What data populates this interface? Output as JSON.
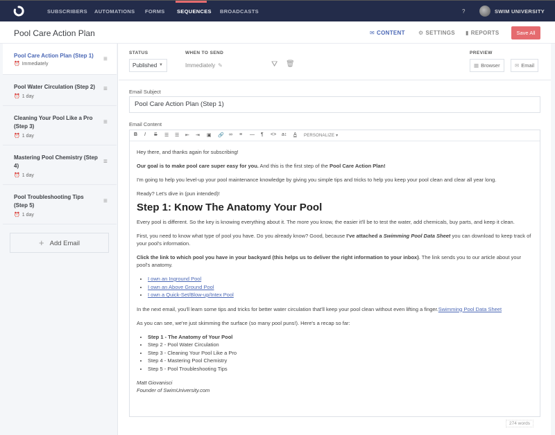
{
  "nav": {
    "items": [
      "SUBSCRIBERS",
      "AUTOMATIONS",
      "FORMS",
      "SEQUENCES",
      "BROADCASTS"
    ],
    "active": "SEQUENCES",
    "help": "?",
    "account": "SWIM UNIVERSITY",
    "accent": "#e56b6f"
  },
  "header": {
    "title": "Pool Care Action Plan",
    "tabs": [
      {
        "label": "CONTENT",
        "icon": "envelope-icon",
        "active": true
      },
      {
        "label": "SETTINGS",
        "icon": "gear-icon",
        "active": false
      },
      {
        "label": "REPORTS",
        "icon": "bar-chart-icon",
        "active": false
      }
    ],
    "save_label": "Save All"
  },
  "sidebar": {
    "emails": [
      {
        "title": "Pool Care Action Plan (Step 1)",
        "delay": "Immediately",
        "active": true
      },
      {
        "title": "Pool Water Circulation (Step 2)",
        "delay": "1 day"
      },
      {
        "title": "Cleaning Your Pool Like a Pro (Step 3)",
        "delay": "1 day"
      },
      {
        "title": "Mastering Pool Chemistry (Step 4)",
        "delay": "1 day"
      },
      {
        "title": "Pool Troubleshooting Tips (Step 5)",
        "delay": "1 day"
      }
    ],
    "add_label": "Add Email"
  },
  "settings": {
    "status_label": "STATUS",
    "status_value": "Published",
    "when_label": "WHEN TO SEND",
    "when_value": "Immediately",
    "preview_label": "PREVIEW",
    "preview_browser": "Browser",
    "preview_email": "Email"
  },
  "email": {
    "subject_label": "Email Subject",
    "subject_value": "Pool Care Action Plan (Step 1)",
    "content_label": "Email Content",
    "toolbar": [
      "B",
      "I",
      "S",
      "ul",
      "ol",
      "outdent",
      "indent",
      "image",
      "link",
      "unlink",
      "align",
      "hr",
      "pilcrow",
      "code",
      "font-size",
      "text-color"
    ],
    "personalize": "PERSONALIZE ▾",
    "body": {
      "p1": "Hey there, and thanks again for subscribing!",
      "p2_bold": "Our goal is to make pool care super easy for you.",
      "p2_rest": " And this is the first step of the ",
      "p2_bold2": "Pool Care Action Plan!",
      "p3": "I'm going to help you level-up your pool maintenance knowledge by giving you simple tips and tricks to help you keep your pool clean and clear all year long.",
      "p4": "Ready? Let's dive in (pun intended)!",
      "heading": "Step 1: Know The Anatomy Your Pool",
      "p5": "Every pool is different. So the key is knowing everything about it. The more you know, the easier it'll be to test the water, add chemicals, buy parts, and keep it clean.",
      "p6_a": "First, you need to know what type of pool you have. Do you already know? Good, because ",
      "p6_bold": "I've attached a ",
      "p6_bi": "Swimming Pool Data Sheet",
      "p6_b": " you can download to keep track of your pool's information.",
      "p7_bold": "Click the link to which pool you have in your backyard (this helps us to deliver the right information to your inbox)",
      "p7_rest": ". The link sends you to our article about your pool's anatomy.",
      "links": [
        "I own an Inground Pool",
        "I own an Above Ground Pool",
        "I own a Quick-Set/Blow-up/Intex Pool"
      ],
      "p8": "In the next email, you'll learn some tips and tricks for better water circulation that'll keep your pool clean without even lifting a finger.",
      "p8_link": "Swimming Pool Data Sheet",
      "p9": "As you can see, we're just skimming the surface (so many pool puns!). Here's a recap so far:",
      "recap": [
        "Step 1 - The Anatomy of Your Pool",
        "Step 2 - Pool Water Circulation",
        "Step 3 - Cleaning Your Pool Like a Pro",
        "Step 4 - Mastering Pool Chemistry",
        "Step 5 - Pool Troubleshooting Tips"
      ],
      "sig_name": "Matt Giovanisci",
      "sig_title": "Founder of SwimUniversity.com"
    },
    "word_count": "274 words"
  }
}
